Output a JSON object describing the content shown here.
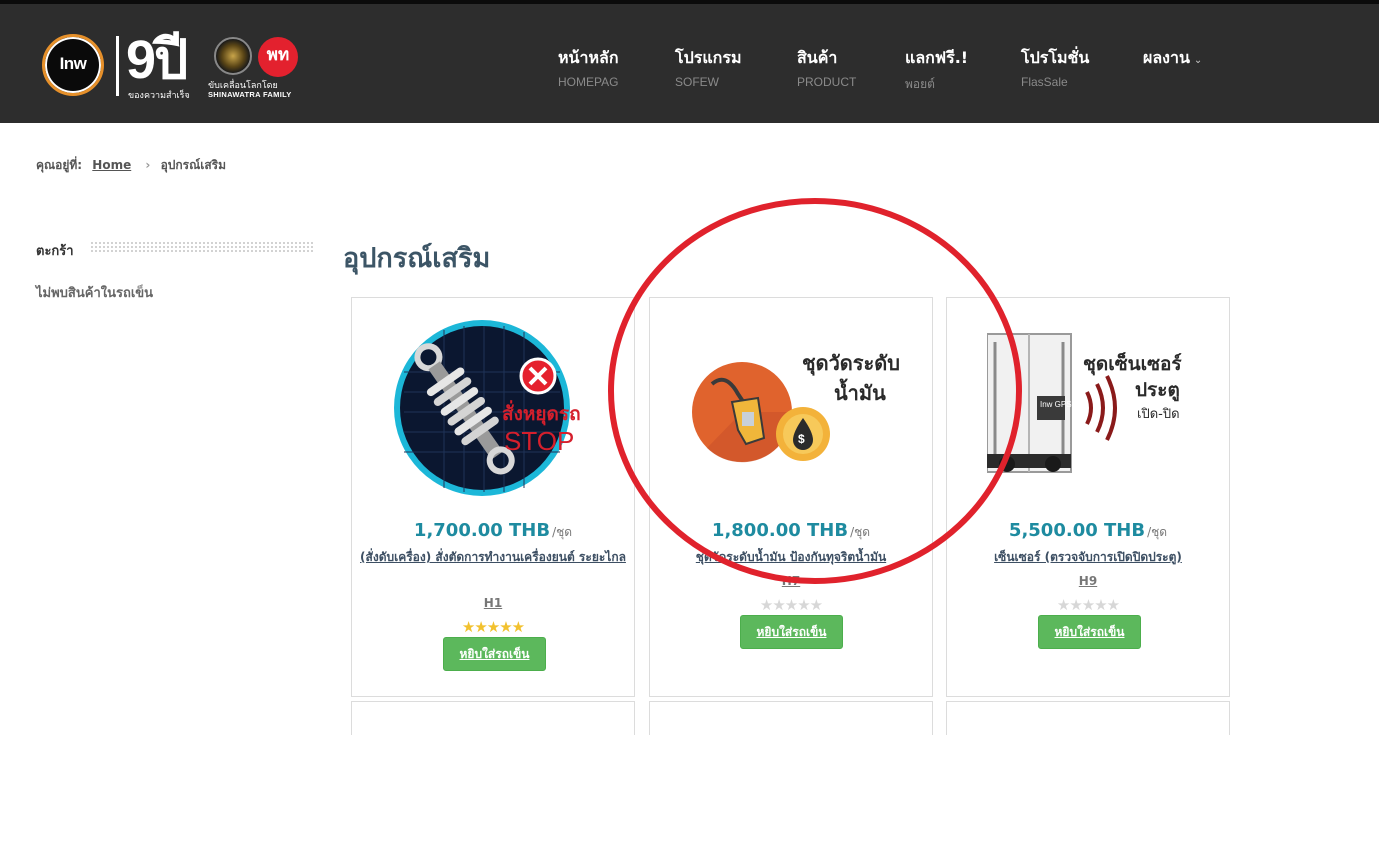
{
  "brand": {
    "logo_text": "Inw",
    "anniversary": "9ปี",
    "anniversary_sub": "ของความสำเร็จ",
    "partner_badge": "พท",
    "partner_line1": "ขับเคลื่อนโลกโดย",
    "partner_line2": "SHINAWATRA FAMILY"
  },
  "nav": [
    {
      "label": "หน้าหลัก",
      "sub": "HOMEPAG"
    },
    {
      "label": "โปรแกรม",
      "sub": "SOFEW"
    },
    {
      "label": "สินค้า",
      "sub": "PRODUCT"
    },
    {
      "label": "แลกฟรี.!",
      "sub": "พอยต์"
    },
    {
      "label": "โปรโมชั่น",
      "sub": "FlasSale"
    },
    {
      "label": "ผลงาน",
      "sub": ""
    }
  ],
  "breadcrumb": {
    "prefix": "คุณอยู่ที่:",
    "home": "Home",
    "sep": "›",
    "current": "อุปกรณ์เสริม"
  },
  "sidebar": {
    "title": "ตะกร้า",
    "empty_text": "ไม่พบสินค้าในรถเข็น"
  },
  "page_title": "อุปกรณ์เสริม",
  "products": [
    {
      "price": "1,700.00 THB",
      "unit": "/ชุด",
      "name": "(สั่งดับเครื่อง) สั่งตัดการทำงานเครื่องยนต์ ระยะไกล",
      "code": "H1",
      "rating": 5,
      "button": "หยิบใส่รถเข็น",
      "image_text1": "สั่งหยุดรถ",
      "image_text2": "STOP"
    },
    {
      "price": "1,800.00 THB",
      "unit": "/ชุด",
      "name": "ชุดวัดระดับน้ำมัน ป้องกันทุจริตน้ำมัน",
      "code": "H7",
      "rating": 0,
      "button": "หยิบใส่รถเข็น",
      "image_text1": "ชุดวัดระดับ",
      "image_text2": "น้ำมัน"
    },
    {
      "price": "5,500.00 THB",
      "unit": "/ชุด",
      "name": "เซ็นเซอร์ (ตรวจจับการเปิดปิดประตู)",
      "code": "H9",
      "rating": 0,
      "button": "หยิบใส่รถเข็น",
      "image_text1": "ชุดเซ็นเซอร์",
      "image_text2": "ประตู",
      "image_text3": "เปิด-ปิด",
      "image_text4": "Inw GPS"
    }
  ],
  "colors": {
    "header_bg": "#2d2d2d",
    "price": "#1e8ba0",
    "button": "#5cb85c",
    "annotation": "#e0222c"
  }
}
